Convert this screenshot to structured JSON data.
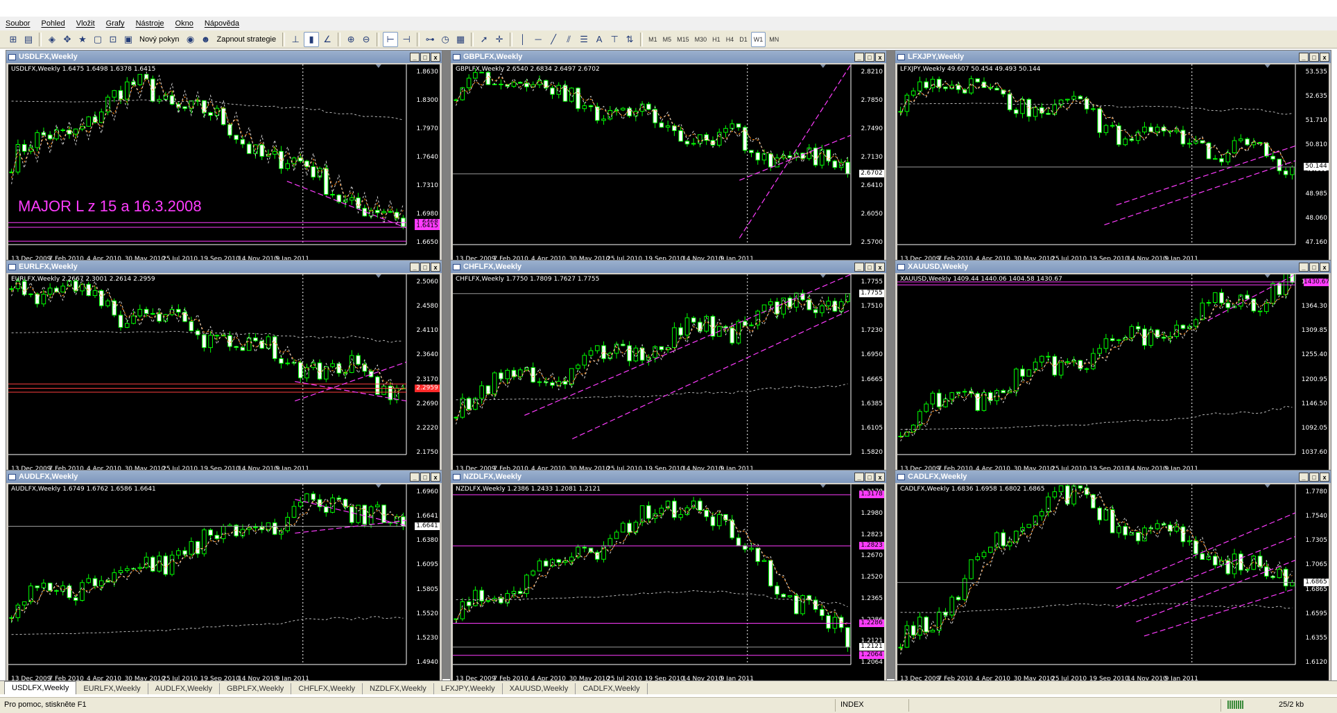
{
  "menu": [
    "Soubor",
    "Pohled",
    "Vložit",
    "Grafy",
    "Nástroje",
    "Okno",
    "Nápověda"
  ],
  "toolbar": {
    "new_order": "Nový pokyn",
    "experts": "Zapnout strategie",
    "text_tool": "A",
    "timeframes": [
      "M1",
      "M5",
      "M15",
      "M30",
      "H1",
      "H4",
      "D1",
      "W1",
      "MN"
    ],
    "active_timeframe": "W1"
  },
  "window_buttons": [
    "_",
    "□",
    "x"
  ],
  "charts": [
    {
      "title": "USDLFX,Weekly",
      "ohlc": "USDLFX,Weekly  1.6475 1.6498 1.6378 1.6415",
      "y_ticks": [
        "1.8630",
        "1.8300",
        "1.7970",
        "1.7640",
        "1.7310",
        "1.6980",
        "1.6650"
      ],
      "y_range": [
        1.615,
        1.885
      ],
      "start": 1.74,
      "peak": 1.855,
      "peak_at": 0.34,
      "end": 1.642,
      "x_ticks": [
        "13 Dec 2009",
        "7 Feb 2010",
        "4 Apr 2010",
        "30 May 2010",
        "25 Jul 2010",
        "19 Sep 2010",
        "14 Nov 2010",
        "9 Jan 2011"
      ],
      "annotation": "MAJOR   L   z   15 a 16.3.2008",
      "price_tags": [
        {
          "label": "1.6468",
          "value": 1.6468,
          "style": "magenta"
        },
        {
          "label": "1.6415",
          "value": 1.6415,
          "style": "magenta"
        }
      ],
      "hlines": [
        {
          "value": 1.648,
          "color": "#ff3cff"
        },
        {
          "value": 1.641,
          "color": "#ff3cff"
        },
        {
          "value": 1.62,
          "color": "#ff3cff"
        }
      ],
      "diagonals": [
        {
          "from": [
            0.7,
            1.71
          ],
          "to": [
            1.0,
            1.64
          ]
        }
      ],
      "mas": [
        {
          "offset": 0.03,
          "color": "#ff8c1a"
        },
        {
          "offset": 0.06,
          "color": "#d8d8d8"
        },
        {
          "offset": 0.1,
          "color": "#b8b8b8",
          "flat": 1.83
        }
      ]
    },
    {
      "title": "GBPLFX,Weekly",
      "ohlc": "GBPLFX,Weekly  2.6540 2.6834 2.6497 2.6702",
      "y_ticks": [
        "2.8210",
        "2.7850",
        "2.7490",
        "2.7130",
        "2.6410",
        "2.6050",
        "2.5700"
      ],
      "y_range": [
        2.56,
        2.84
      ],
      "start": 2.79,
      "peak": 2.825,
      "peak_at": 0.05,
      "end": 2.67,
      "x_ticks": [
        "13 Dec 2009",
        "7 Feb 2010",
        "4 Apr 2010",
        "30 May 2010",
        "25 Jul 2010",
        "19 Sep 2010",
        "14 Nov 2010",
        "9 Jan 2011"
      ],
      "price_tags": [
        {
          "label": "2.6702",
          "value": 2.6702,
          "style": "white"
        }
      ],
      "hlines": [
        {
          "value": 2.67,
          "color": "#9a9a9a"
        }
      ],
      "diagonals": [
        {
          "from": [
            0.72,
            2.66
          ],
          "to": [
            1.0,
            2.73
          ]
        },
        {
          "from": [
            0.72,
            2.57
          ],
          "to": [
            1.0,
            2.84
          ]
        }
      ],
      "mas": [
        {
          "offset": 0.015,
          "color": "#ff8c1a"
        },
        {
          "offset": 0.03,
          "color": "#d8d8d8"
        }
      ]
    },
    {
      "title": "LFXJPY,Weekly",
      "ohlc": "LFXJPY,Weekly  49.607 50.454 49.493 50.144",
      "y_ticks": [
        "53.535",
        "52.635",
        "51.710",
        "50.810",
        "49.885",
        "48.985",
        "48.060",
        "47.160"
      ],
      "y_range": [
        47.0,
        54.3
      ],
      "start": 52.5,
      "peak": 53.8,
      "peak_at": 0.05,
      "end": 50.144,
      "x_ticks": [
        "13 Dec 2009",
        "7 Feb 2010",
        "4 Apr 2010",
        "30 May 2010",
        "25 Jul 2010",
        "19 Sep 2010",
        "14 Nov 2010",
        "9 Jan 2011"
      ],
      "price_tags": [
        {
          "label": "50.144",
          "value": 50.144,
          "style": "white"
        }
      ],
      "hlines": [
        {
          "value": 50.144,
          "color": "#9a9a9a"
        }
      ],
      "diagonals": [
        {
          "from": [
            0.52,
            47.8
          ],
          "to": [
            1.0,
            50.4
          ]
        },
        {
          "from": [
            0.55,
            48.6
          ],
          "to": [
            1.0,
            51.0
          ]
        }
      ],
      "mas": [
        {
          "offset": 0.3,
          "color": "#ff8c1a"
        },
        {
          "offset": 0.5,
          "color": "#d8d8d8"
        },
        {
          "offset": 0.8,
          "color": "#b8b8b8",
          "flat": 52.7
        }
      ]
    },
    {
      "title": "EURLFX,Weekly",
      "ohlc": "EURLFX,Weekly  2.2667 2.3001 2.2614 2.2959",
      "y_ticks": [
        "2.5060",
        "2.4580",
        "2.4110",
        "2.3640",
        "2.3170",
        "2.2690",
        "2.2220",
        "2.1750"
      ],
      "y_range": [
        2.16,
        2.53
      ],
      "start": 2.52,
      "peak": 2.52,
      "peak_at": 0.0,
      "end": 2.295,
      "x_ticks": [
        "13 Dec 2009",
        "7 Feb 2010",
        "4 Apr 2010",
        "30 May 2010",
        "25 Jul 2010",
        "19 Sep 2010",
        "14 Nov 2010",
        "9 Jan 2011"
      ],
      "price_tags": [
        {
          "label": "2.2959",
          "value": 2.2959,
          "style": "red"
        }
      ],
      "hlines": [
        {
          "value": 2.305,
          "color": "#ff4040"
        },
        {
          "value": 2.296,
          "color": "#ff4040"
        },
        {
          "value": 2.288,
          "color": "#ff4040"
        }
      ],
      "diagonals": [
        {
          "from": [
            0.72,
            2.27
          ],
          "to": [
            1.0,
            2.35
          ]
        },
        {
          "from": [
            0.72,
            2.31
          ],
          "to": [
            1.0,
            2.27
          ]
        }
      ],
      "mas": [
        {
          "offset": 0.02,
          "color": "#ff8c1a"
        },
        {
          "offset": 0.05,
          "color": "#d8d8d8"
        },
        {
          "offset": 0.1,
          "color": "#b8b8b8",
          "flat": 2.41
        }
      ]
    },
    {
      "title": "CHFLFX,Weekly",
      "ohlc": "CHFLFX,Weekly  1.7750 1.7809 1.7627 1.7755",
      "y_ticks": [
        "1.7755",
        "1.7510",
        "1.7230",
        "1.6950",
        "1.6665",
        "1.6385",
        "1.6105",
        "1.5820"
      ],
      "y_range": [
        1.57,
        1.8
      ],
      "start": 1.64,
      "peak": 1.65,
      "peak_at": 0.05,
      "end": 1.7755,
      "x_ticks": [
        "13 Dec 2009",
        "7 Feb 2010",
        "4 Apr 2010",
        "30 May 2010",
        "25 Jul 2010",
        "19 Sep 2010",
        "14 Nov 2010",
        "9 Jan 2011"
      ],
      "price_tags": [
        {
          "label": "1.7755",
          "value": 1.7755,
          "style": "white"
        }
      ],
      "hlines": [
        {
          "value": 1.7755,
          "color": "#9a9a9a"
        }
      ],
      "diagonals": [
        {
          "from": [
            0.18,
            1.62
          ],
          "to": [
            1.0,
            1.8
          ]
        },
        {
          "from": [
            0.3,
            1.59
          ],
          "to": [
            1.0,
            1.755
          ]
        }
      ],
      "mas": [
        {
          "offset": 0.015,
          "color": "#ff8c1a"
        },
        {
          "offset": 0.03,
          "color": "#d8d8d8"
        },
        {
          "offset": 0.06,
          "color": "#b8b8b8",
          "flat": 1.64
        }
      ]
    },
    {
      "title": "XAUUSD,Weekly",
      "ohlc": "XAUUSD,Weekly  1409.44 1440.06 1404.58 1430.67",
      "y_ticks": [
        "1430.67",
        "1364.30",
        "1309.85",
        "1255.40",
        "1200.95",
        "1146.50",
        "1092.05",
        "1037.60"
      ],
      "y_range": [
        1020,
        1450
      ],
      "start": 1110,
      "peak": 1115,
      "peak_at": 0.05,
      "end": 1430.67,
      "x_ticks": [
        "13 Dec 2009",
        "7 Feb 2010",
        "4 Apr 2010",
        "30 May 2010",
        "25 Jul 2010",
        "19 Sep 2010",
        "14 Nov 2010",
        "9 Jan 2011"
      ],
      "price_tags": [
        {
          "label": "1430.67",
          "value": 1430.67,
          "style": "magenta"
        }
      ],
      "hlines": [
        {
          "value": 1432,
          "color": "#ff3cff"
        },
        {
          "value": 1425,
          "color": "#ff3cff"
        }
      ],
      "diagonals": [
        {
          "from": [
            0.78,
            1340
          ],
          "to": [
            1.0,
            1450
          ]
        }
      ],
      "mas": [
        {
          "offset": 15,
          "color": "#ff8c1a"
        },
        {
          "offset": 40,
          "color": "#d8d8d8"
        },
        {
          "offset": 90,
          "color": "#b8b8b8",
          "flat": 1080
        }
      ]
    },
    {
      "title": "AUDLFX,Weekly",
      "ohlc": "AUDLFX,Weekly  1.6749 1.6762 1.6586 1.6641",
      "y_ticks": [
        "1.6960",
        "1.6641",
        "1.6380",
        "1.6095",
        "1.5805",
        "1.5520",
        "1.5230",
        "1.4940"
      ],
      "y_range": [
        1.48,
        1.72
      ],
      "start": 1.56,
      "peak": 1.7,
      "peak_at": 0.85,
      "end": 1.6641,
      "x_ticks": [
        "13 Dec 2009",
        "7 Feb 2010",
        "4 Apr 2010",
        "30 May 2010",
        "25 Jul 2010",
        "19 Sep 2010",
        "14 Nov 2010",
        "9 Jan 2011"
      ],
      "price_tags": [
        {
          "label": "1.6641",
          "value": 1.6641,
          "style": "white"
        }
      ],
      "hlines": [
        {
          "value": 1.6641,
          "color": "#9a9a9a"
        }
      ],
      "diagonals": [
        {
          "from": [
            0.72,
            1.7
          ],
          "to": [
            1.0,
            1.665
          ]
        },
        {
          "from": [
            0.72,
            1.655
          ],
          "to": [
            1.0,
            1.672
          ]
        }
      ],
      "mas": [
        {
          "offset": 0.01,
          "color": "#ff8c1a"
        },
        {
          "offset": 0.02,
          "color": "#d8d8d8"
        },
        {
          "offset": 0.07,
          "color": "#b8b8b8",
          "flat": 1.52
        }
      ]
    },
    {
      "title": "NZDLFX,Weekly",
      "ohlc": "NZDLFX,Weekly  1.2386 1.2433 1.2081 1.2121",
      "y_ticks": [
        "1.3178",
        "1.2980",
        "1.2823",
        "1.2670",
        "1.2520",
        "1.2365",
        "1.2286",
        "1.2121",
        "1.2064"
      ],
      "y_range": [
        1.2,
        1.325
      ],
      "start": 1.235,
      "peak": 1.315,
      "peak_at": 0.6,
      "end": 1.2121,
      "x_ticks": [
        "13 Dec 2009",
        "7 Feb 2010",
        "4 Apr 2010",
        "30 May 2010",
        "25 Jul 2010",
        "19 Sep 2010",
        "14 Nov 2010",
        "9 Jan 2011"
      ],
      "price_tags": [
        {
          "label": "1.3178",
          "value": 1.3178,
          "style": "magenta"
        },
        {
          "label": "1.2823",
          "value": 1.2823,
          "style": "magenta"
        },
        {
          "label": "1.2286",
          "value": 1.2286,
          "style": "magenta"
        },
        {
          "label": "1.2121",
          "value": 1.2121,
          "style": "white"
        },
        {
          "label": "1.2064",
          "value": 1.2064,
          "style": "magenta"
        }
      ],
      "hlines": [
        {
          "value": 1.3178,
          "color": "#ff3cff"
        },
        {
          "value": 1.2823,
          "color": "#ff3cff"
        },
        {
          "value": 1.2286,
          "color": "#ff3cff"
        },
        {
          "value": 1.2121,
          "color": "#9a9a9a"
        },
        {
          "value": 1.2064,
          "color": "#ff3cff"
        }
      ],
      "diagonals": [],
      "mas": [
        {
          "offset": 0.005,
          "color": "#ff8c1a"
        },
        {
          "offset": 0.01,
          "color": "#d8d8d8"
        },
        {
          "offset": 0.02,
          "color": "#b8b8b8",
          "flat": 1.245
        }
      ]
    },
    {
      "title": "CADLFX,Weekly",
      "ohlc": "CADLFX,Weekly  1.6836 1.6958 1.6802 1.6865",
      "y_ticks": [
        "1.7780",
        "1.7540",
        "1.7305",
        "1.7065",
        "1.6865",
        "1.6595",
        "1.6355",
        "1.6120"
      ],
      "y_range": [
        1.6,
        1.79
      ],
      "start": 1.62,
      "peak": 1.78,
      "peak_at": 0.38,
      "end": 1.6865,
      "x_ticks": [
        "13 Dec 2009",
        "7 Feb 2010",
        "4 Apr 2010",
        "30 May 2010",
        "25 Jul 2010",
        "19 Sep 2010",
        "14 Nov 2010",
        "9 Jan 2011"
      ],
      "price_tags": [
        {
          "label": "1.6865",
          "value": 1.6865,
          "style": "white"
        }
      ],
      "hlines": [
        {
          "value": 1.6865,
          "color": "#9a9a9a"
        }
      ],
      "diagonals": [
        {
          "from": [
            0.55,
            1.68
          ],
          "to": [
            1.0,
            1.76
          ]
        },
        {
          "from": [
            0.55,
            1.66
          ],
          "to": [
            1.0,
            1.735
          ]
        },
        {
          "from": [
            0.6,
            1.645
          ],
          "to": [
            1.0,
            1.71
          ]
        },
        {
          "from": [
            0.62,
            1.63
          ],
          "to": [
            1.0,
            1.68
          ]
        }
      ],
      "mas": [
        {
          "offset": 0.01,
          "color": "#ff8c1a"
        },
        {
          "offset": 0.025,
          "color": "#d8d8d8"
        },
        {
          "offset": 0.06,
          "color": "#b8b8b8",
          "flat": 1.655
        }
      ]
    }
  ],
  "tabs": [
    "USDLFX,Weekly",
    "EURLFX,Weekly",
    "AUDLFX,Weekly",
    "GBPLFX,Weekly",
    "CHFLFX,Weekly",
    "NZDLFX,Weekly",
    "LFXJPY,Weekly",
    "XAUUSD,Weekly",
    "CADLFX,Weekly"
  ],
  "status": {
    "help": "Pro pomoc, stiskněte F1",
    "profile": "INDEX",
    "traffic": "25/2 kb"
  },
  "colors": {
    "bull": "#00ff00",
    "bear": "#ffffff",
    "grid": "#ffffff",
    "background": "#000000"
  }
}
